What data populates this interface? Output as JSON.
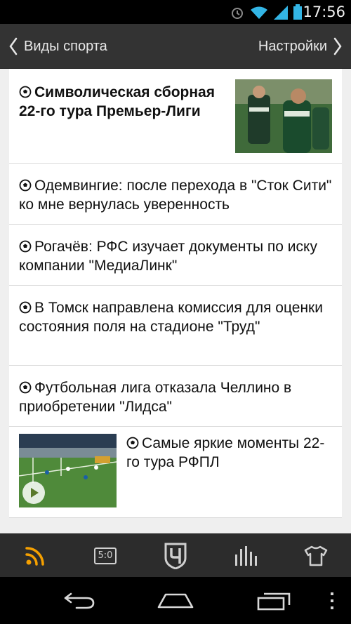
{
  "status": {
    "time": "17:56"
  },
  "header": {
    "back_label": "Виды спорта",
    "settings_label": "Настройки"
  },
  "colors": {
    "accent": "#f5a000",
    "header_bg": "#333333",
    "tab_bg": "#2c2c2c"
  },
  "news": [
    {
      "title": "Символическая сборная 22-го тура Премьер-Лиги",
      "type": "featured",
      "icon": "soccer-ball-icon"
    },
    {
      "title": "Одемвингие: после перехода в \"Сток Сити\" ко мне вернулась уверенность",
      "type": "plain",
      "icon": "soccer-ball-icon"
    },
    {
      "title": "Рогачёв: РФС изучает документы по иску компании \"МедиаЛинк\"",
      "type": "plain",
      "icon": "soccer-ball-icon"
    },
    {
      "title": "В Томск направлена комиссия для оценки состояния поля на стадионе \"Труд\"",
      "type": "plain",
      "icon": "soccer-ball-icon"
    },
    {
      "title": "Футбольная лига отказала Челлино в приобретении \"Лидса\"",
      "type": "plain",
      "icon": "soccer-ball-icon"
    },
    {
      "title": "Самые яркие моменты 22-го тура РФПЛ",
      "type": "video",
      "icon": "soccer-ball-icon"
    }
  ],
  "tabs": [
    {
      "name": "news-feed",
      "icon": "rss-icon",
      "active": true
    },
    {
      "name": "scores",
      "icon": "scoreboard-icon",
      "label": "5:0"
    },
    {
      "name": "championat",
      "icon": "championat-logo-icon"
    },
    {
      "name": "stats",
      "icon": "bar-chart-icon"
    },
    {
      "name": "teams",
      "icon": "jersey-icon"
    }
  ]
}
